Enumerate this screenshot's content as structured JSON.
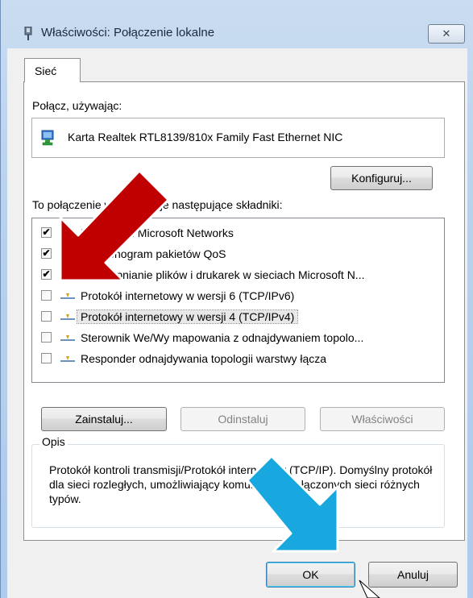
{
  "window": {
    "title": "Właściwości: Połączenie lokalne",
    "close_label": "✕"
  },
  "tabs": [
    {
      "label": "Sieć"
    }
  ],
  "connect_using_label": "Połącz, używając:",
  "adapter_name": "Karta Realtek RTL8139/810x Family Fast Ethernet NIC",
  "configure_button": "Konfiguruj...",
  "components_label": "To połączenie wykorzystuje następujące składniki:",
  "components": [
    {
      "label": "Klient sieci Microsoft Networks",
      "checked": true,
      "icon": "network-client-icon"
    },
    {
      "label": "Harmonogram pakietów QoS",
      "checked": true,
      "icon": "qos-icon"
    },
    {
      "label": "Udostępnianie plików i drukarek w sieciach Microsoft N...",
      "checked": true,
      "icon": "file-printer-sharing-icon"
    },
    {
      "label": "Protokół internetowy w wersji 6 (TCP/IPv6)",
      "checked": false,
      "icon": "protocol-icon"
    },
    {
      "label": "Protokół internetowy w wersji 4 (TCP/IPv4)",
      "checked": false,
      "icon": "protocol-icon",
      "selected": true
    },
    {
      "label": "Sterownik We/Wy mapowania z odnajdywaniem topolo...",
      "checked": false,
      "icon": "protocol-icon"
    },
    {
      "label": "Responder odnajdywania topologii warstwy łącza",
      "checked": false,
      "icon": "protocol-icon"
    }
  ],
  "buttons": {
    "install": "Zainstaluj...",
    "uninstall": "Odinstaluj",
    "properties": "Właściwości",
    "ok": "OK",
    "cancel": "Anuluj"
  },
  "description": {
    "legend": "Opis",
    "text": "Protokół kontroli transmisji/Protokół internetowy (TCP/IP). Domyślny protokół dla sieci rozległych, umożliwiający komunikację połączonych sieci różnych typów."
  },
  "colors": {
    "red_arrow": "#c00000",
    "blue_arrow": "#19a7e0"
  }
}
